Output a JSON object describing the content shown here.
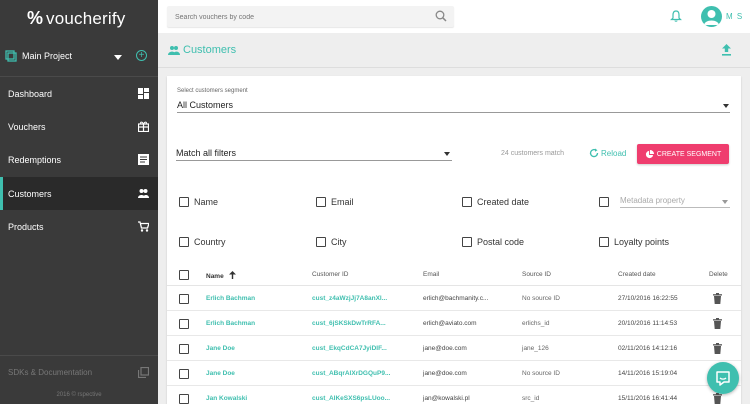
{
  "app": {
    "logo_mark": "%",
    "logo_text": "voucherify",
    "project": "Main Project",
    "accent_color": "#3fbfaf",
    "danger_color": "#ef3d6e"
  },
  "sidebar": {
    "items": [
      {
        "label": "Dashboard",
        "icon": "dashboard-icon"
      },
      {
        "label": "Vouchers",
        "icon": "gift-icon"
      },
      {
        "label": "Redemptions",
        "icon": "list-icon"
      },
      {
        "label": "Customers",
        "icon": "people-icon",
        "active": true
      },
      {
        "label": "Products",
        "icon": "cart-icon"
      }
    ],
    "sdk_label": "SDKs & Documentation",
    "copyright": "2016 © rspective"
  },
  "topbar": {
    "search_placeholder": "Search vouchers by code",
    "user_initials": "M S"
  },
  "page": {
    "title": "Customers"
  },
  "segment": {
    "label": "Select customers segment",
    "value": "All Customers"
  },
  "filters": {
    "match_value": "Match all filters",
    "match_count": "24 customers match",
    "reload_label": "Reload",
    "create_segment_label": "CREATE SEGMENT",
    "checkboxes": [
      "Name",
      "Email",
      "Created date",
      "Country",
      "City",
      "Postal code",
      "Loyalty points"
    ],
    "metadata_placeholder": "Metadata property"
  },
  "table": {
    "headers": {
      "name": "Name",
      "customer_id": "Customer ID",
      "email": "Email",
      "source_id": "Source ID",
      "created_date": "Created date",
      "delete": "Delete"
    },
    "rows": [
      {
        "name": "Erlich Bachman",
        "customer_id": "cust_z4aWzjJj7A8anXl...",
        "email": "erlich@bachmanity.c...",
        "source_id": "No source ID",
        "created": "27/10/2016 16:22:55"
      },
      {
        "name": "Erlich Bachman",
        "customer_id": "cust_6jSKSkDwTrRFA...",
        "email": "erlich@aviato.com",
        "source_id": "erlichs_id",
        "created": "20/10/2016 11:14:53"
      },
      {
        "name": "Jane Doe",
        "customer_id": "cust_EkqCdCA7JyiDIF...",
        "email": "jane@doe.com",
        "source_id": "jane_126",
        "created": "02/11/2016 14:12:16"
      },
      {
        "name": "Jane Doe",
        "customer_id": "cust_ABqrAlXrDGQuP9...",
        "email": "jane@doe.com",
        "source_id": "No source ID",
        "created": "14/11/2016 15:19:04"
      },
      {
        "name": "Jan Kowalski",
        "customer_id": "cust_AlKeSXS6psLUoo...",
        "email": "jan@kowalski.pl",
        "source_id": "src_id",
        "created": "15/11/2016 16:41:44"
      }
    ]
  }
}
